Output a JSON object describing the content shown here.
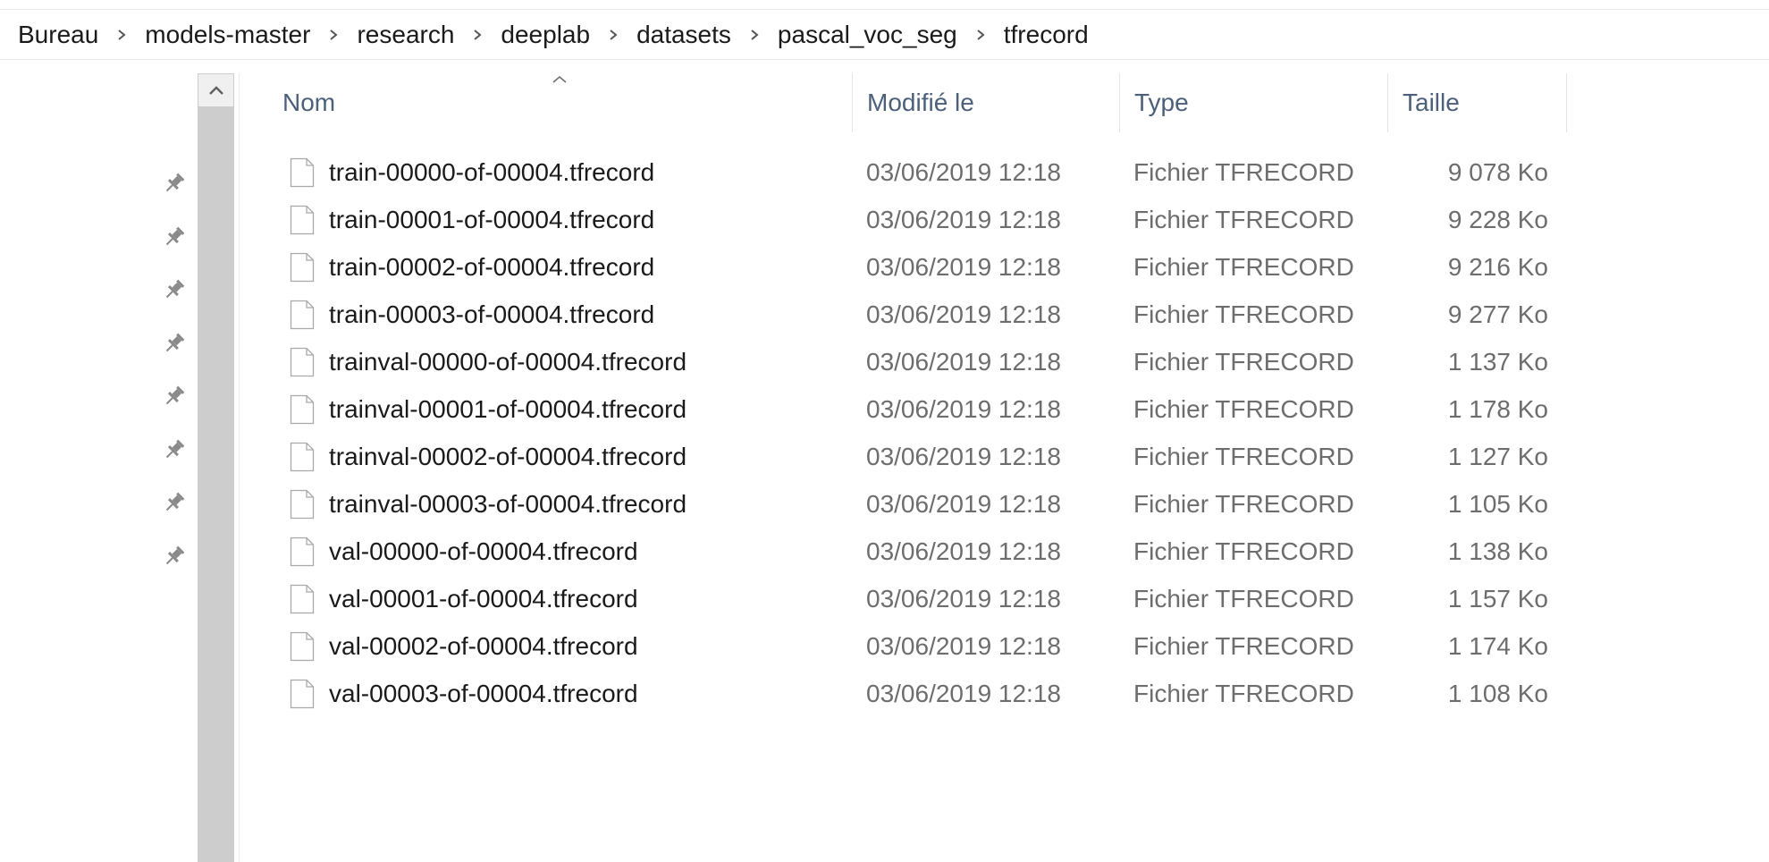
{
  "breadcrumb": [
    "Bureau",
    "models-master",
    "research",
    "deeplab",
    "datasets",
    "pascal_voc_seg",
    "tfrecord"
  ],
  "columns": {
    "name": "Nom",
    "modified": "Modifié le",
    "type": "Type",
    "size": "Taille"
  },
  "pinned_count": 8,
  "files": [
    {
      "name": "train-00000-of-00004.tfrecord",
      "modified": "03/06/2019 12:18",
      "type": "Fichier TFRECORD",
      "size": "9 078 Ko"
    },
    {
      "name": "train-00001-of-00004.tfrecord",
      "modified": "03/06/2019 12:18",
      "type": "Fichier TFRECORD",
      "size": "9 228 Ko"
    },
    {
      "name": "train-00002-of-00004.tfrecord",
      "modified": "03/06/2019 12:18",
      "type": "Fichier TFRECORD",
      "size": "9 216 Ko"
    },
    {
      "name": "train-00003-of-00004.tfrecord",
      "modified": "03/06/2019 12:18",
      "type": "Fichier TFRECORD",
      "size": "9 277 Ko"
    },
    {
      "name": "trainval-00000-of-00004.tfrecord",
      "modified": "03/06/2019 12:18",
      "type": "Fichier TFRECORD",
      "size": "1 137 Ko"
    },
    {
      "name": "trainval-00001-of-00004.tfrecord",
      "modified": "03/06/2019 12:18",
      "type": "Fichier TFRECORD",
      "size": "1 178 Ko"
    },
    {
      "name": "trainval-00002-of-00004.tfrecord",
      "modified": "03/06/2019 12:18",
      "type": "Fichier TFRECORD",
      "size": "1 127 Ko"
    },
    {
      "name": "trainval-00003-of-00004.tfrecord",
      "modified": "03/06/2019 12:18",
      "type": "Fichier TFRECORD",
      "size": "1 105 Ko"
    },
    {
      "name": "val-00000-of-00004.tfrecord",
      "modified": "03/06/2019 12:18",
      "type": "Fichier TFRECORD",
      "size": "1 138 Ko"
    },
    {
      "name": "val-00001-of-00004.tfrecord",
      "modified": "03/06/2019 12:18",
      "type": "Fichier TFRECORD",
      "size": "1 157 Ko"
    },
    {
      "name": "val-00002-of-00004.tfrecord",
      "modified": "03/06/2019 12:18",
      "type": "Fichier TFRECORD",
      "size": "1 174 Ko"
    },
    {
      "name": "val-00003-of-00004.tfrecord",
      "modified": "03/06/2019 12:18",
      "type": "Fichier TFRECORD",
      "size": "1 108 Ko"
    }
  ],
  "icons": {
    "breadcrumb_separator": "chevron-right-icon",
    "pin": "pin-icon",
    "file": "file-icon",
    "scroll_up": "chevron-up-icon",
    "sort": "sort-ascending-icon"
  },
  "colors": {
    "header_text": "#4c607a",
    "secondary_text": "#6d6d6d",
    "primary_text": "#1a1a1a",
    "scrollbar": "#cdcdcd"
  }
}
